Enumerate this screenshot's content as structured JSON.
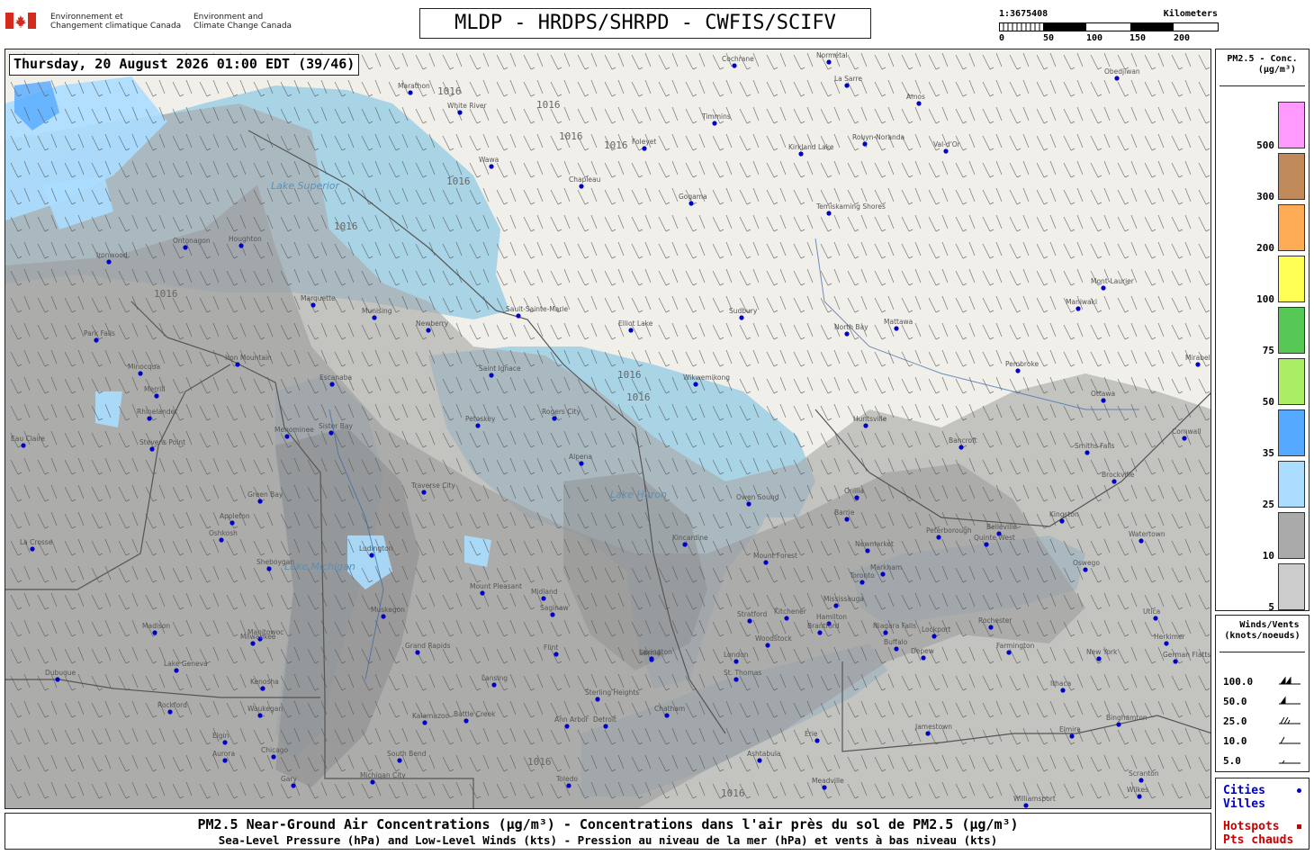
{
  "header": {
    "agency_fr": [
      "Environnement et",
      "Changement climatique Canada"
    ],
    "agency_en": [
      "Environment and",
      "Climate Change Canada"
    ],
    "title": "MLDP - HRDPS/SHRPD - CWFIS/SCIFV"
  },
  "scale": {
    "ratio": "1:3675408",
    "unit": "Kilometers",
    "ticks": [
      "0",
      "50",
      "100",
      "150",
      "200"
    ]
  },
  "timestamp": "Thursday, 20 August 2026 01:00 EDT (39/46)",
  "legend_conc": {
    "title_l1": "PM2.5 - Conc.",
    "title_l2": "(μg/m³)",
    "levels": [
      {
        "value": "500",
        "color": "#ff99ff"
      },
      {
        "value": "300",
        "color": "#c08a5a"
      },
      {
        "value": "200",
        "color": "#ffaa55"
      },
      {
        "value": "100",
        "color": "#ffff55"
      },
      {
        "value": "75",
        "color": "#55c855"
      },
      {
        "value": "50",
        "color": "#aaee66"
      },
      {
        "value": "35",
        "color": "#55aaff"
      },
      {
        "value": "25",
        "color": "#aaddff"
      },
      {
        "value": "10",
        "color": "#aaaaaa"
      },
      {
        "value": "5",
        "color": "#cccccc"
      }
    ]
  },
  "legend_wind": {
    "title_l1": "Winds/Vents",
    "title_l2": "(knots/noeuds)",
    "rows": [
      "100.0",
      "50.0",
      "25.0",
      "10.0",
      "5.0"
    ]
  },
  "legend_cities": {
    "cities": "Cities",
    "villes": "Villes",
    "hotspots": "Hotspots",
    "pts_chauds": "Pts chauds",
    "city_color": "#0000cc",
    "hotspot_color": "#cc0000"
  },
  "footer": {
    "line1": "PM2.5 Near-Ground Air Concentrations (μg/m³) - Concentrations dans l'air près du sol de PM2.5 (μg/m³)",
    "line2": "Sea-Level Pressure (hPa) and Low-Level Winds (kts) - Pression au niveau de la mer (hPa) et vents à bas niveau (kts)"
  },
  "map": {
    "isobar_label": "1016",
    "water_labels": [
      "Lake Superior",
      "Lake Michigan",
      "Lake Huron"
    ],
    "cities": [
      {
        "name": "Cochrane"
      },
      {
        "name": "Normétal"
      },
      {
        "name": "La Sarre"
      },
      {
        "name": "Amos"
      },
      {
        "name": "Obedjiwan"
      },
      {
        "name": "Marathon"
      },
      {
        "name": "White River"
      },
      {
        "name": "Timmins"
      },
      {
        "name": "Foleyet"
      },
      {
        "name": "Kirkland Lake"
      },
      {
        "name": "Rouyn-Noranda"
      },
      {
        "name": "Val-d'Or"
      },
      {
        "name": "Wawa"
      },
      {
        "name": "Chapleau"
      },
      {
        "name": "Gogama"
      },
      {
        "name": "Temiskaming Shores"
      },
      {
        "name": "Mont-Laurier"
      },
      {
        "name": "Maniwaki"
      },
      {
        "name": "Sault-Sainte-Marie"
      },
      {
        "name": "Newberry"
      },
      {
        "name": "Elliot Lake"
      },
      {
        "name": "Sudbury"
      },
      {
        "name": "North Bay"
      },
      {
        "name": "Mattawa"
      },
      {
        "name": "Pembroke"
      },
      {
        "name": "Ottawa"
      },
      {
        "name": "Cornwall"
      },
      {
        "name": "Munising"
      },
      {
        "name": "Marquette"
      },
      {
        "name": "Saint Ignace"
      },
      {
        "name": "Wikwemikong"
      },
      {
        "name": "Huntsville"
      },
      {
        "name": "Escanaba"
      },
      {
        "name": "Petoskey"
      },
      {
        "name": "Rogers City"
      },
      {
        "name": "Alpena"
      },
      {
        "name": "Bancroft"
      },
      {
        "name": "Smiths Falls"
      },
      {
        "name": "Brockville"
      },
      {
        "name": "Kingston"
      },
      {
        "name": "Traverse City"
      },
      {
        "name": "Owen Sound"
      },
      {
        "name": "Orillia"
      },
      {
        "name": "Barrie"
      },
      {
        "name": "Peterborough"
      },
      {
        "name": "Belleville"
      },
      {
        "name": "Quinte West"
      },
      {
        "name": "Watertown"
      },
      {
        "name": "Green Bay"
      },
      {
        "name": "Appleton"
      },
      {
        "name": "Oshkosh"
      },
      {
        "name": "Sheboygan"
      },
      {
        "name": "Ludington"
      },
      {
        "name": "Kincardine"
      },
      {
        "name": "Mount Forest"
      },
      {
        "name": "Newmarket"
      },
      {
        "name": "Markham"
      },
      {
        "name": "Toronto"
      },
      {
        "name": "Mississauga"
      },
      {
        "name": "Oswego"
      },
      {
        "name": "Mount Pleasant"
      },
      {
        "name": "Midland"
      },
      {
        "name": "Saginaw"
      },
      {
        "name": "Kitchener"
      },
      {
        "name": "Hamilton"
      },
      {
        "name": "Niagara Falls"
      },
      {
        "name": "Rochester"
      },
      {
        "name": "Utica"
      },
      {
        "name": "Manitowoc"
      },
      {
        "name": "Milwaukee"
      },
      {
        "name": "Muskegon"
      },
      {
        "name": "Grand Rapids"
      },
      {
        "name": "Flint"
      },
      {
        "name": "Lexington"
      },
      {
        "name": "Sarnia"
      },
      {
        "name": "Stratford"
      },
      {
        "name": "Woodstock"
      },
      {
        "name": "Brantford"
      },
      {
        "name": "London"
      },
      {
        "name": "St. Thomas"
      },
      {
        "name": "Buffalo"
      },
      {
        "name": "Depew"
      },
      {
        "name": "Lockport"
      },
      {
        "name": "Farmington"
      },
      {
        "name": "Ithaca"
      },
      {
        "name": "Binghamton"
      },
      {
        "name": "Kenosha"
      },
      {
        "name": "Waukegan"
      },
      {
        "name": "Lansing"
      },
      {
        "name": "Sterling Heights"
      },
      {
        "name": "Detroit"
      },
      {
        "name": "Ann Arbor"
      },
      {
        "name": "Kalamazoo"
      },
      {
        "name": "Battle Creek"
      },
      {
        "name": "Chatham"
      },
      {
        "name": "Jamestown"
      },
      {
        "name": "Erie"
      },
      {
        "name": "Elmira"
      },
      {
        "name": "Dubuque"
      },
      {
        "name": "Rockford"
      },
      {
        "name": "Elgin"
      },
      {
        "name": "Aurora"
      },
      {
        "name": "Chicago"
      },
      {
        "name": "Gary"
      },
      {
        "name": "Michigan City"
      },
      {
        "name": "South Bend"
      },
      {
        "name": "Toledo"
      },
      {
        "name": "Ashtabula"
      },
      {
        "name": "Meadville"
      },
      {
        "name": "Williamsport"
      },
      {
        "name": "Scranton"
      },
      {
        "name": "Wilkes"
      },
      {
        "name": "Stevens Point"
      },
      {
        "name": "Merrill"
      },
      {
        "name": "Iron Mountain"
      },
      {
        "name": "Menominee"
      },
      {
        "name": "Sister Bay"
      },
      {
        "name": "La Crosse"
      },
      {
        "name": "Madison"
      },
      {
        "name": "Lake Geneva"
      },
      {
        "name": "Park Falls"
      },
      {
        "name": "Minocqua"
      },
      {
        "name": "Rhinelander"
      },
      {
        "name": "Houghton"
      },
      {
        "name": "Ontonagon"
      },
      {
        "name": "Ironwood"
      },
      {
        "name": "Eau Claire"
      },
      {
        "name": "New York"
      },
      {
        "name": "Herkimer"
      },
      {
        "name": "German Flatts"
      },
      {
        "name": "Mirabel"
      }
    ]
  }
}
